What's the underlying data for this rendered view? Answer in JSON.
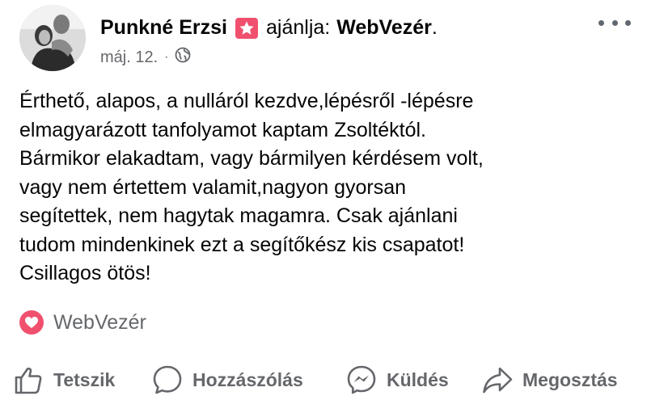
{
  "post": {
    "author_name": "Punkné Erzsi",
    "recommend_verb": "ajánlja:",
    "page_name": "WebVezér",
    "period": ".",
    "date": "máj. 12.",
    "separator": "·",
    "privacy_icon": "globe-icon",
    "more_icon": "more-options-icon"
  },
  "review": {
    "lines": [
      "Érthető, alapos, a nulláról kezdve,lépésről -lépésre",
      "elmagyarázott tanfolyamot kaptam Zsoltéktól.",
      "Bármikor elakadtam, vagy bármilyen kérdésem volt,",
      "vagy nem értettem valamit,nagyon gyorsan",
      "segítettek, nem hagytak magamra. Csak ajánlani",
      "tudom mindenkinek ezt a segítőkész kis csapatot!",
      "Csillagos ötös!"
    ]
  },
  "tag": {
    "icon": "heart-icon",
    "label": "WebVezér"
  },
  "actions": {
    "like": "Tetszik",
    "comment": "Hozzászólás",
    "send": "Küldés",
    "share": "Megosztás"
  },
  "colors": {
    "accent": "#f0506e",
    "secondary_text": "#65676b",
    "primary_text": "#050505"
  }
}
